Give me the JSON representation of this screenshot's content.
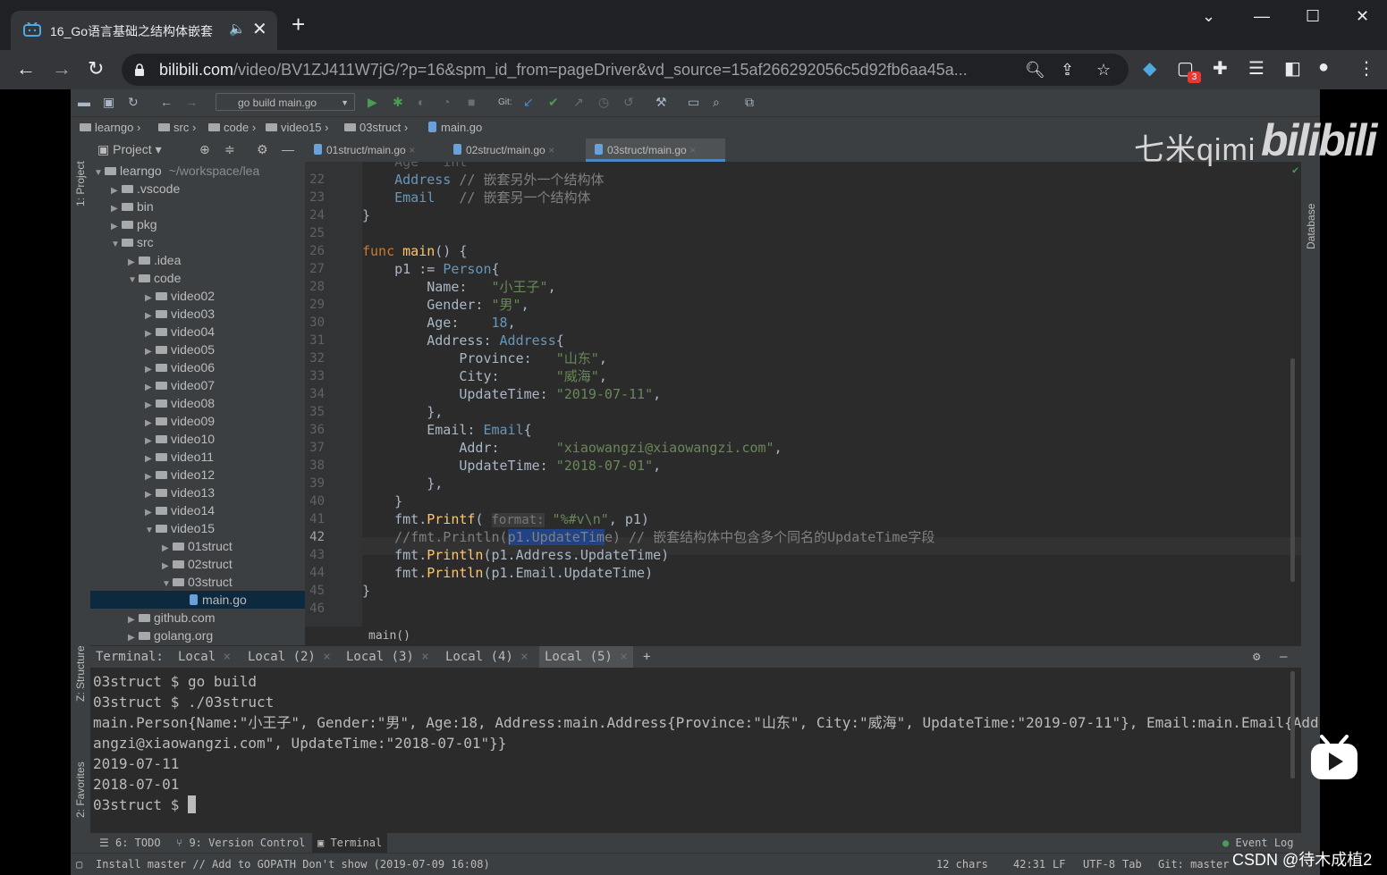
{
  "browser": {
    "tab_title": "16_Go语言基础之结构体嵌套",
    "new_tab_label": "+",
    "url_domain": "bilibili.com",
    "url_path": "/video/BV1ZJ411W7jG/?p=16&spm_id_from=pageDriver&vd_source=15af266292056c5d92fb6aa45a...",
    "extension_badge": "3"
  },
  "ide": {
    "run_config": "go build main.go",
    "git_label": "Git:",
    "breadcrumbs": [
      "learngo",
      "src",
      "code",
      "video15",
      "03struct",
      "main.go"
    ],
    "project_header": "Project",
    "left_tools": [
      "1: Project",
      "Z: Structure",
      "2: Favorites"
    ],
    "right_tools": [
      "Database"
    ],
    "tree": [
      {
        "label": "learngo",
        "extra": "~/workspace/lea",
        "open": true,
        "depth": 0,
        "type": "folder"
      },
      {
        "label": ".vscode",
        "depth": 1,
        "type": "folder",
        "open": false
      },
      {
        "label": "bin",
        "depth": 1,
        "type": "folder",
        "open": false
      },
      {
        "label": "pkg",
        "depth": 1,
        "type": "folder",
        "open": false
      },
      {
        "label": "src",
        "depth": 1,
        "type": "folder",
        "open": true
      },
      {
        "label": ".idea",
        "depth": 2,
        "type": "folder",
        "open": false
      },
      {
        "label": "code",
        "depth": 2,
        "type": "folder",
        "open": true
      },
      {
        "label": "video02",
        "depth": 3,
        "type": "folder",
        "open": false
      },
      {
        "label": "video03",
        "depth": 3,
        "type": "folder",
        "open": false
      },
      {
        "label": "video04",
        "depth": 3,
        "type": "folder",
        "open": false
      },
      {
        "label": "video05",
        "depth": 3,
        "type": "folder",
        "open": false
      },
      {
        "label": "video06",
        "depth": 3,
        "type": "folder",
        "open": false
      },
      {
        "label": "video07",
        "depth": 3,
        "type": "folder",
        "open": false
      },
      {
        "label": "video08",
        "depth": 3,
        "type": "folder",
        "open": false
      },
      {
        "label": "video09",
        "depth": 3,
        "type": "folder",
        "open": false
      },
      {
        "label": "video10",
        "depth": 3,
        "type": "folder",
        "open": false
      },
      {
        "label": "video11",
        "depth": 3,
        "type": "folder",
        "open": false
      },
      {
        "label": "video12",
        "depth": 3,
        "type": "folder",
        "open": false
      },
      {
        "label": "video13",
        "depth": 3,
        "type": "folder",
        "open": false
      },
      {
        "label": "video14",
        "depth": 3,
        "type": "folder",
        "open": false
      },
      {
        "label": "video15",
        "depth": 3,
        "type": "folder",
        "open": true
      },
      {
        "label": "01struct",
        "depth": 4,
        "type": "folder",
        "open": false
      },
      {
        "label": "02struct",
        "depth": 4,
        "type": "folder",
        "open": false
      },
      {
        "label": "03struct",
        "depth": 4,
        "type": "folder",
        "open": true
      },
      {
        "label": "main.go",
        "depth": 5,
        "type": "file",
        "selected": true
      },
      {
        "label": "github.com",
        "depth": 2,
        "type": "folder",
        "open": false
      },
      {
        "label": "golang.org",
        "depth": 2,
        "type": "folder",
        "open": false
      }
    ],
    "editor_tabs": [
      {
        "label": "01struct/main.go",
        "active": false
      },
      {
        "label": "02struct/main.go",
        "active": false
      },
      {
        "label": "03struct/main.go",
        "active": true
      }
    ],
    "line_numbers": [
      "22",
      "23",
      "24",
      "25",
      "26",
      "27",
      "28",
      "29",
      "30",
      "31",
      "32",
      "33",
      "34",
      "35",
      "36",
      "37",
      "38",
      "39",
      "40",
      "41",
      "42",
      "43",
      "44",
      "45",
      "46"
    ],
    "code_first_partial": "    Age   int",
    "code_footer": "main()",
    "terminal": {
      "label": "Terminal:",
      "tabs": [
        "Local",
        "Local (2)",
        "Local (3)",
        "Local (4)",
        "Local (5)"
      ],
      "add_label": "+",
      "lines": [
        "03struct $ go build",
        "03struct $ ./03struct",
        "main.Person{Name:\"小王子\", Gender:\"男\", Age:18, Address:main.Address{Province:\"山东\", City:\"威海\", UpdateTime:\"2019-07-11\"}, Email:main.Email{Add",
        "angzi@xiaowangzi.com\", UpdateTime:\"2018-07-01\"}}",
        "2019-07-11",
        "2018-07-01",
        "03struct $ "
      ]
    },
    "bottom_tools": [
      "6: TODO",
      "9: Version Control",
      "Terminal"
    ],
    "event_log": "Event Log",
    "status_message": "Install master // Add to GOPATH Don't show (2019-07-09 16:08)",
    "status_right": [
      "12 chars",
      "42:31",
      "LF",
      "UTF-8",
      "Tab",
      "Git: master"
    ]
  },
  "overlay": {
    "watermark_text": "七米qimi",
    "watermark_logo": "bilibili",
    "csdn_credit": "CSDN @待木成植2"
  },
  "colors": {
    "keyword": "#cc7832",
    "function": "#ffc66d",
    "string": "#6a8759",
    "comment": "#808080",
    "number": "#6897bb",
    "field": "#9876aa",
    "selection": "#214283"
  }
}
